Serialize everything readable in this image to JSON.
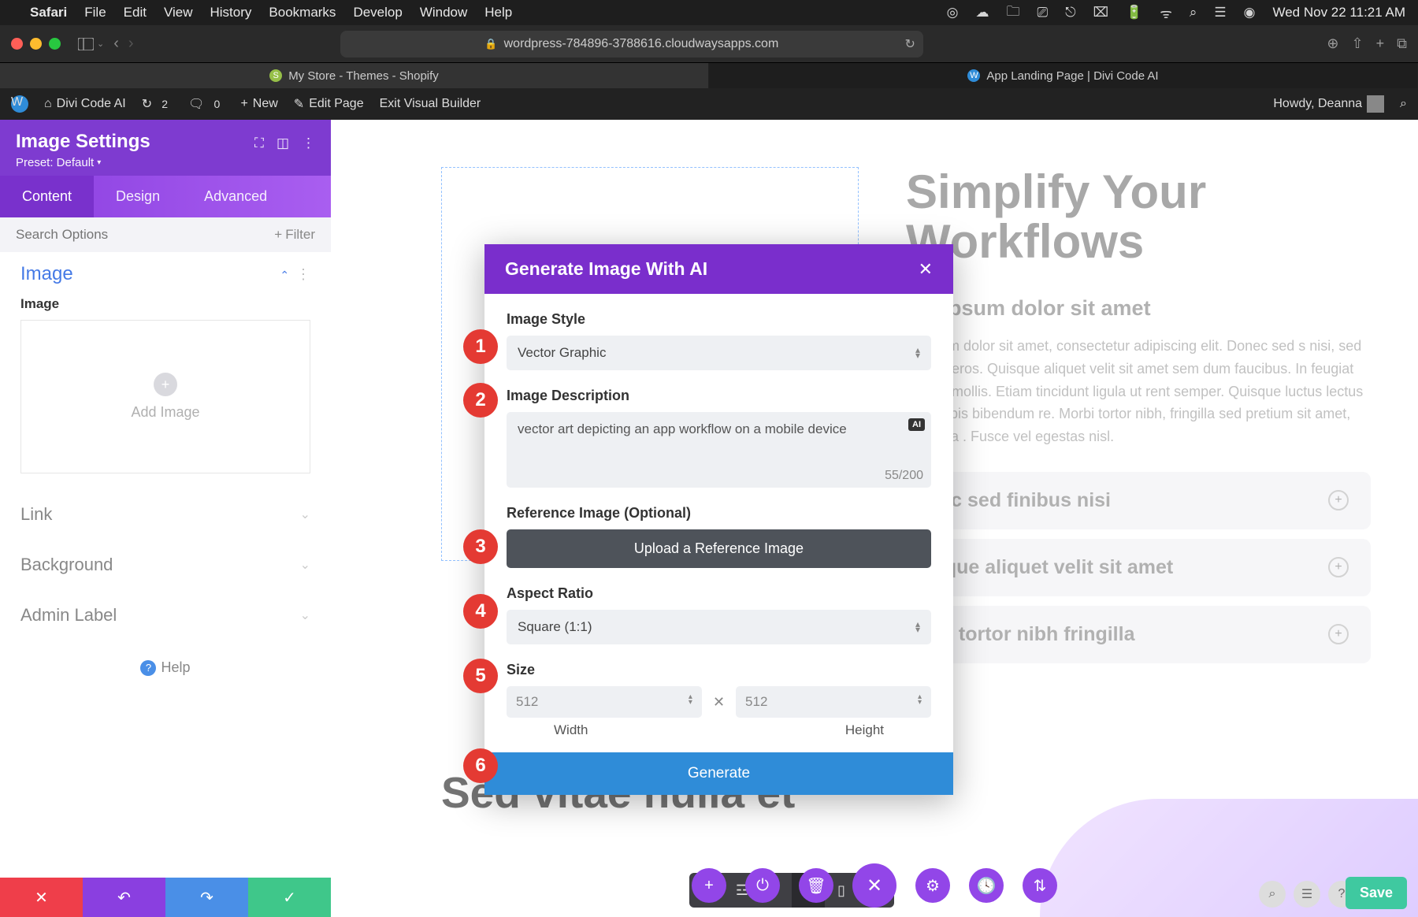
{
  "mac": {
    "app": "Safari",
    "menu": [
      "File",
      "Edit",
      "View",
      "History",
      "Bookmarks",
      "Develop",
      "Window",
      "Help"
    ],
    "clock": "Wed Nov 22  11:21 AM"
  },
  "safari": {
    "url": "wordpress-784896-3788616.cloudwaysapps.com",
    "tabs": [
      {
        "label": "My Store - Themes - Shopify"
      },
      {
        "label": "App Landing Page | Divi Code AI"
      }
    ]
  },
  "wp": {
    "site": "Divi Code AI",
    "refresh": "2",
    "comments": "0",
    "new": "New",
    "edit": "Edit Page",
    "exit": "Exit Visual Builder",
    "howdy": "Howdy, Deanna"
  },
  "panel": {
    "title": "Image Settings",
    "preset": "Preset: Default",
    "tabs": [
      "Content",
      "Design",
      "Advanced"
    ],
    "search_placeholder": "Search Options",
    "filter": "Filter",
    "sections": {
      "image": "Image",
      "link": "Link",
      "background": "Background",
      "admin": "Admin Label"
    },
    "image_label": "Image",
    "add_image": "Add Image",
    "help": "Help"
  },
  "hero": {
    "h1a": "Simplify Your",
    "h1b": "Workflows",
    "sub": "em ipsum dolor sit amet",
    "p": "m ipsum dolor sit amet, consectetur adipiscing elit. Donec sed s nisi, sed dictum eros. Quisque aliquet velit sit amet sem dum faucibus. In feugiat aliquet mollis. Etiam tincidunt ligula ut rent semper. Quisque luctus lectus non turpis bibendum re. Morbi tortor nibh, fringilla sed pretium sit amet, pharetra . Fusce vel egestas nisl.",
    "acc": [
      "nec sed finibus nisi",
      "isque aliquet velit sit amet",
      "rbi tortor nibh fringilla"
    ],
    "sub2": "Sed vitae nulla et"
  },
  "modal": {
    "title": "Generate Image With AI",
    "style_label": "Image Style",
    "style_value": "Vector Graphic",
    "desc_label": "Image Description",
    "desc_value": "vector art depicting an app workflow on a mobile device",
    "desc_count": "55/200",
    "ref_label": "Reference Image (Optional)",
    "upload": "Upload a Reference Image",
    "aspect_label": "Aspect Ratio",
    "aspect_value": "Square (1:1)",
    "size_label": "Size",
    "width": "512",
    "height": "512",
    "width_label": "Width",
    "height_label": "Height",
    "generate": "Generate",
    "ai_badge": "AI"
  },
  "save": "Save"
}
